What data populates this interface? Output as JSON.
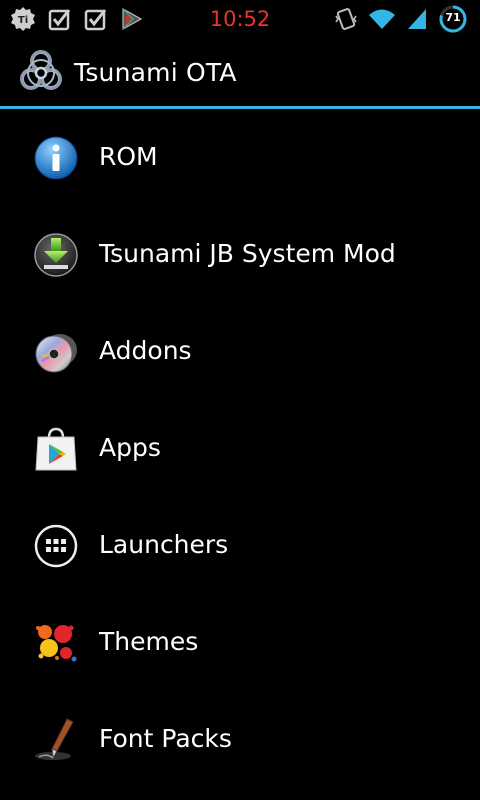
{
  "status_bar": {
    "time": "10:52",
    "battery_level": "71",
    "left_icons": [
      "tablet-ti-icon",
      "checkbox-icon",
      "checkbox-icon",
      "play-store-notification-icon"
    ],
    "right_icons": [
      "vibrate-icon",
      "wifi-icon",
      "signal-icon",
      "battery-icon"
    ],
    "colors": {
      "clock": "#e8352a",
      "accent": "#33b5e5"
    }
  },
  "action_bar": {
    "title": "Tsunami OTA",
    "icon": "biohazard-icon",
    "divider_color": "#33b5e5"
  },
  "menu": {
    "items": [
      {
        "label": "ROM",
        "icon": "info-icon"
      },
      {
        "label": "Tsunami JB System Mod",
        "icon": "download-icon"
      },
      {
        "label": "Addons",
        "icon": "disc-icon"
      },
      {
        "label": "Apps",
        "icon": "play-store-bag-icon"
      },
      {
        "label": "Launchers",
        "icon": "app-drawer-icon"
      },
      {
        "label": "Themes",
        "icon": "paint-splatter-icon"
      },
      {
        "label": "Font Packs",
        "icon": "pen-nib-icon"
      }
    ]
  }
}
